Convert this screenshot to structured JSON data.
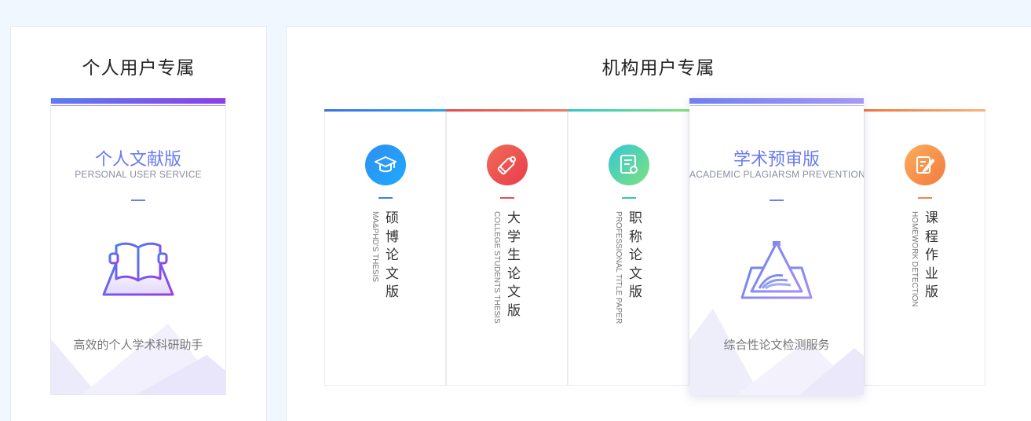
{
  "personal": {
    "heading": "个人用户专属",
    "card": {
      "title": "个人文献版",
      "subtitle": "PERSONAL USER SERVICE",
      "desc": "高效的个人学术科研助手"
    }
  },
  "institution": {
    "heading": "机构用户专属",
    "cards": [
      {
        "chars": [
          "硕",
          "博",
          "论",
          "文",
          "版"
        ],
        "english": "MA&PHD'S THESIS",
        "icon": "graduation-cap-icon",
        "color": "#3a7ff0"
      },
      {
        "chars": [
          "大",
          "学",
          "生",
          "论",
          "文",
          "版"
        ],
        "english": "COLLEGE STUDENTS THESIS",
        "icon": "diploma-scroll-icon",
        "color": "#ea4c4c"
      },
      {
        "chars": [
          "职",
          "称",
          "论",
          "文",
          "版"
        ],
        "english": "PROFESSIONAL TITLE PAPER",
        "icon": "certificate-document-icon",
        "color": "#3ac7b0"
      },
      {
        "chars": [
          "课",
          "程",
          "作",
          "业",
          "版"
        ],
        "english": "HOMEWORK DETECTION",
        "icon": "edit-note-icon",
        "color": "#f2843f"
      }
    ],
    "featured": {
      "title": "学术预审版",
      "subtitle": "ACADEMIC PLAGIARSM PREVENTION",
      "desc": "综合性论文检测服务"
    }
  },
  "colors": {
    "accent": "#6b7af0",
    "background": "#f1f7fe"
  }
}
